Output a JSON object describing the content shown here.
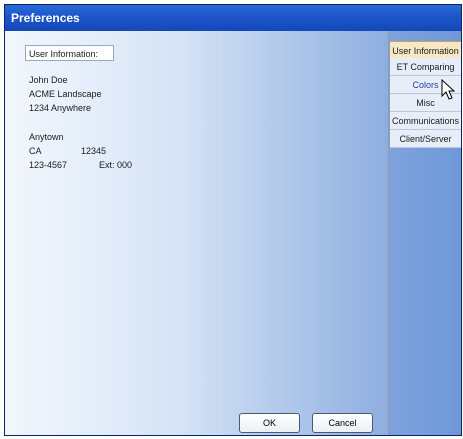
{
  "window": {
    "title": "Preferences"
  },
  "user_info": {
    "section_label": "User Information:",
    "name": "John Doe",
    "company": "ACME Landscape",
    "address": "1234 Anywhere",
    "city": "Anytown",
    "state": "CA",
    "zip": "12345",
    "phone": "123-4567",
    "ext": "Ext: 000"
  },
  "buttons": {
    "ok": "OK",
    "cancel": "Cancel"
  },
  "tabs": [
    {
      "label": "User Information"
    },
    {
      "label": "ET Comparing"
    },
    {
      "label": "Colors"
    },
    {
      "label": "Misc"
    },
    {
      "label": "Communications"
    },
    {
      "label": "Client/Server"
    }
  ],
  "icons": {
    "cursor": "arrow-cursor-icon"
  }
}
